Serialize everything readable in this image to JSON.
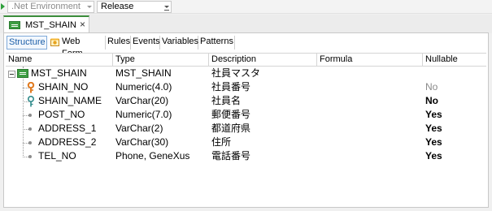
{
  "toolbar": {
    "environment": ".Net Environment",
    "configuration": "Release"
  },
  "document_tab": {
    "title": "MST_SHAIN",
    "close_glyph": "×"
  },
  "subtabs": [
    {
      "label": "Structure",
      "active": true
    },
    {
      "label": "Web Form",
      "active": false
    },
    {
      "label": "Rules",
      "active": false
    },
    {
      "label": "Events",
      "active": false
    },
    {
      "label": "Variables",
      "active": false
    },
    {
      "label": "Patterns",
      "active": false
    }
  ],
  "grid": {
    "columns": [
      "Name",
      "Type",
      "Description",
      "Formula",
      "Nullable"
    ],
    "root": {
      "name": "MST_SHAIN",
      "type": "MST_SHAIN",
      "description": "社員マスタ",
      "formula": "",
      "nullable": "",
      "icon": "transaction-icon"
    },
    "attributes": [
      {
        "name": "SHAIN_NO",
        "type": "Numeric(4.0)",
        "description": "社員番号",
        "formula": "",
        "nullable": "No",
        "icon": "primary-key-icon",
        "nullable_style": "gray"
      },
      {
        "name": "SHAIN_NAME",
        "type": "VarChar(20)",
        "description": "社員名",
        "formula": "",
        "nullable": "No",
        "icon": "candidate-key-icon",
        "nullable_style": "bold"
      },
      {
        "name": "POST_NO",
        "type": "Numeric(7.0)",
        "description": "郵便番号",
        "formula": "",
        "nullable": "Yes",
        "icon": "attribute-bullet-icon",
        "nullable_style": "bold"
      },
      {
        "name": "ADDRESS_1",
        "type": "VarChar(2)",
        "description": "都道府県",
        "formula": "",
        "nullable": "Yes",
        "icon": "attribute-bullet-icon",
        "nullable_style": "bold"
      },
      {
        "name": "ADDRESS_2",
        "type": "VarChar(30)",
        "description": "住所",
        "formula": "",
        "nullable": "Yes",
        "icon": "attribute-bullet-icon",
        "nullable_style": "bold"
      },
      {
        "name": "TEL_NO",
        "type": "Phone, GeneXus",
        "description": "電話番号",
        "formula": "",
        "nullable": "Yes",
        "icon": "attribute-bullet-icon",
        "nullable_style": "bold"
      }
    ]
  },
  "colors": {
    "accent_green": "#3e9e43",
    "active_tab_blue": "#1d5fa8",
    "key_orange": "#e07a1f",
    "key_teal": "#2f8a8a"
  }
}
